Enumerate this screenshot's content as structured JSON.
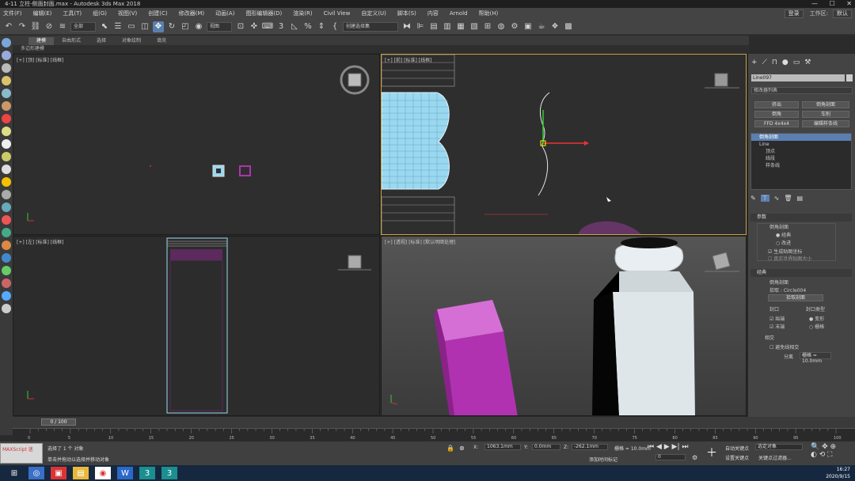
{
  "window": {
    "title": "4-11  立柱-侧面封面.max - Autodesk 3ds Max 2018",
    "controls": [
      "—",
      "☐",
      "✕"
    ]
  },
  "menu": [
    "文件(F)",
    "编辑(E)",
    "工具(T)",
    "组(G)",
    "视图(V)",
    "创建(C)",
    "修改器(M)",
    "动画(A)",
    "图形编辑器(D)",
    "渲染(R)",
    "Civil View",
    "自定义(U)",
    "脚本(S)",
    "内容",
    "Arnold",
    "帮助(H)"
  ],
  "menu_right": {
    "user": "登录",
    "workspace_label": "工作区:",
    "workspace": "默认"
  },
  "toolbar": {
    "selection_set": "全部",
    "ref_coord": "视图",
    "named_selection": "创建选择集"
  },
  "ribbon": {
    "tabs": [
      "建模",
      "自由形式",
      "选择",
      "对象绘制",
      "填充"
    ],
    "active": 0,
    "sub": "多边形建模"
  },
  "viewports": {
    "top": "[+] [顶] [标准] [线框]",
    "front": "[+] [前] [标准] [线框]",
    "left": "[+] [左] [标准] [线框]",
    "persp": "[+] [透视] [标准] [默认明暗处理]"
  },
  "cmdpanel": {
    "object_name": "Line097",
    "modifier_list": "修改器列表",
    "buttons": [
      "挤出",
      "倒角剖面",
      "倒角",
      "车削",
      "FFD 4x4x4",
      "编辑样条线"
    ],
    "stack": [
      "倒角剖面",
      "Line",
      "顶点",
      "线段",
      "样条线"
    ],
    "rollout_params": "参数",
    "bevel_profile_label": "倒角剖面",
    "radio_classic": "经典",
    "radio_improved": "改进",
    "gen_mapping": "生成贴图坐标",
    "real_world": "真实世界贴图大小",
    "rollout_classic": "经典",
    "profile_label": "倒角剖面",
    "pick_label": "拾取",
    "profile_value": "Circle004",
    "pick_button": "拾取剖面",
    "cap_label": "封口",
    "cap_type_label": "封口类型",
    "cap_start": "始端",
    "cap_end": "末端",
    "cap_morph": "变形",
    "cap_grid": "栅格",
    "intersect_label": "相交",
    "avoid_intersect": "避免线相交",
    "separation_label": "分离",
    "separation_value": "1.0mm"
  },
  "timeline": {
    "frame": "0 / 100",
    "ticks": [
      "0",
      "5",
      "10",
      "15",
      "20",
      "25",
      "30",
      "35",
      "40",
      "45",
      "50",
      "55",
      "60",
      "65",
      "70",
      "75",
      "80",
      "85",
      "90",
      "95",
      "100"
    ]
  },
  "status": {
    "maxscript": "MAXScript 迷",
    "selected": "选择了 1 个 对象",
    "prompt": "单击并拖动以选择并移动对象",
    "x": "1063.1mm",
    "y": "0.0mm",
    "z": "-262.1mm",
    "grid_label": "栅格 = 10.0mm",
    "add_tag": "添加时间标记",
    "autokey": "自动关键点",
    "selection_obj": "选定对象",
    "setkey": "设置关键点",
    "keyfilter": "关键点过滤器...",
    "frame_input": "0"
  },
  "taskbar": {
    "time": "16:27",
    "date": "2020/9/15"
  },
  "colors": {
    "select_blue": "#5b7fb0",
    "wire_cyan": "#9ad8f0",
    "magenta": "#b032b0",
    "viewport_border_active": "#c8a040"
  }
}
